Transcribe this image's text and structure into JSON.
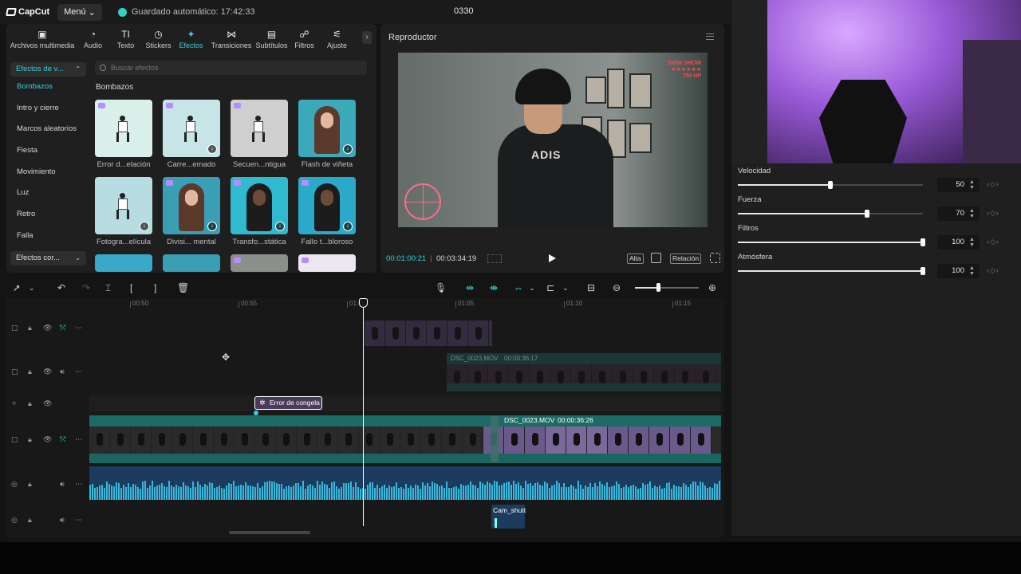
{
  "app": {
    "logo": "CapCut",
    "menu_label": "Menú",
    "autosave": "Guardado automático: 17:42:33",
    "project_title": "0330"
  },
  "tabs": [
    {
      "label": "Archivos multimedia",
      "icon": "media-icon"
    },
    {
      "label": "Audio",
      "icon": "audio-icon"
    },
    {
      "label": "Texto",
      "icon": "text-icon"
    },
    {
      "label": "Stickers",
      "icon": "stickers-icon"
    },
    {
      "label": "Efectos",
      "icon": "effects-icon",
      "active": true
    },
    {
      "label": "Transiciones",
      "icon": "transitions-icon"
    },
    {
      "label": "Subtítulos",
      "icon": "subtitles-icon"
    },
    {
      "label": "Filtros",
      "icon": "filters-icon"
    },
    {
      "label": "Ajuste",
      "icon": "adjust-icon"
    }
  ],
  "effects_sidebar": {
    "header": "Efectos de v...",
    "items": [
      "Bombazos",
      "Intro y cierre",
      "Marcos aleatorios",
      "Fiesta",
      "Movimiento",
      "Luz",
      "Retro",
      "Falla"
    ],
    "active": "Bombazos",
    "footer": "Efectos cor..."
  },
  "search": {
    "placeholder": "Buscar efectos"
  },
  "effects_section_title": "Bombazos",
  "effects": [
    {
      "label": "Error d...elación",
      "premium": true,
      "download": false
    },
    {
      "label": "Carre...emado",
      "premium": true,
      "download": true
    },
    {
      "label": "Secuen...ntigua",
      "premium": true,
      "download": false
    },
    {
      "label": "Flash de viñeta",
      "premium": false,
      "download": true
    },
    {
      "label": "Fotogra...elícula",
      "premium": false,
      "download": true
    },
    {
      "label": "Divisi... mental",
      "premium": true,
      "download": true
    },
    {
      "label": "Transfo...stática",
      "premium": true,
      "download": true
    },
    {
      "label": "Fallo t...bloroso",
      "premium": true,
      "download": true
    }
  ],
  "player": {
    "title": "Reproductor",
    "current_time": "00:01:00:21",
    "total_time": "00:03:34:19",
    "quality_label": "Alta",
    "ratio_label": "Relación",
    "video_text": "ADIS",
    "hud_lines": [
      "50/50 SHOW",
      "★★★★★★",
      "750 HP"
    ]
  },
  "timeline": {
    "ruler_labels": [
      "00:50",
      "00:55",
      "01:00",
      "01:05",
      "01:10",
      "01:15"
    ],
    "effect_clip_label": "Error de congela",
    "upper_clip_label": "DSC_0023.MOV",
    "upper_clip_duration": "00:00:36:17",
    "main_clip_label": "DSC_0023.MOV",
    "main_clip_duration": "00:00:36:26",
    "sfx_label": "Cam_shutt"
  },
  "properties": [
    {
      "label": "Velocidad",
      "value": "50",
      "fraction": 0.5
    },
    {
      "label": "Fuerza",
      "value": "70",
      "fraction": 0.7
    },
    {
      "label": "Filtros",
      "value": "100",
      "fraction": 1.0
    },
    {
      "label": "Atmósfera",
      "value": "100",
      "fraction": 1.0
    }
  ],
  "colors": {
    "accent": "#35d0d7",
    "main_clip": "#1d6b66",
    "audio_clip": "#1b3c5e",
    "effect_clip": "#4a3a5c"
  }
}
